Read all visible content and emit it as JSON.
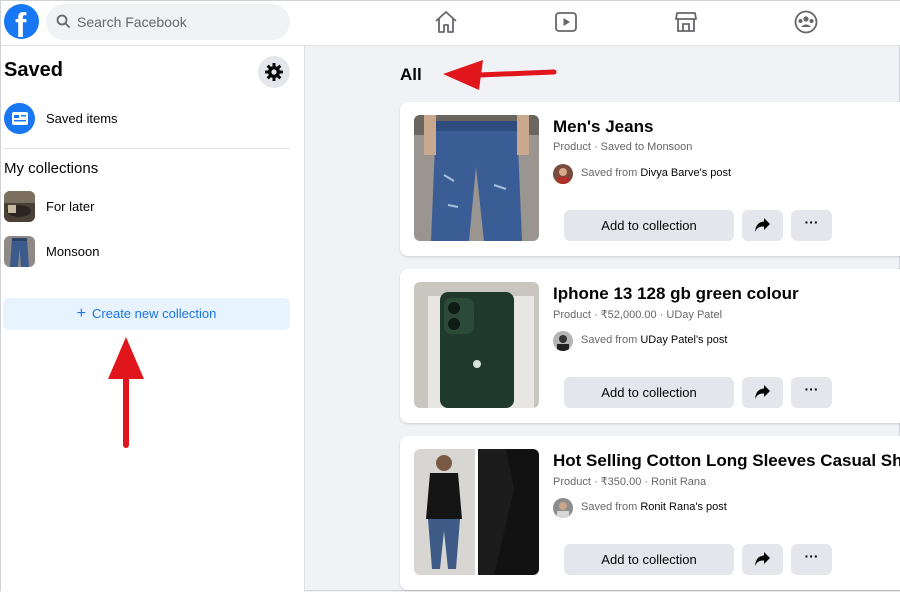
{
  "header": {
    "logo_letter": "f",
    "search_placeholder": "Search Facebook",
    "nav": [
      "home-icon",
      "watch-icon",
      "marketplace-icon",
      "groups-icon"
    ]
  },
  "sidebar": {
    "title": "Saved",
    "saved_items_label": "Saved items",
    "collections_heading": "My collections",
    "collections": [
      {
        "label": "For later"
      },
      {
        "label": "Monsoon"
      }
    ],
    "create_label": "Create new collection",
    "create_icon": "+"
  },
  "main": {
    "title": "All",
    "cards": [
      {
        "name": "Men's Jeans",
        "meta": "Product · Saved to Monsoon",
        "saved_from": "Saved from",
        "source": "Divya Barve's post",
        "add_label": "Add to collection",
        "more_label": "···"
      },
      {
        "name": "Iphone 13 128 gb green colour",
        "meta": "Product · ₹52,000.00 · UDay Patel",
        "saved_from": "Saved from",
        "source": "UDay Patel's post",
        "add_label": "Add to collection",
        "more_label": "···"
      },
      {
        "name": "Hot Selling Cotton Long Sleeves Casual Sh",
        "meta": "Product · ₹350.00 · Ronit Rana",
        "saved_from": "Saved from",
        "source": "Ronit Rana's post",
        "add_label": "Add to collection",
        "more_label": "···"
      }
    ]
  },
  "colors": {
    "brand": "#1877f2",
    "annotation_arrow": "#e0161c",
    "create_button_bg": "#e7f3ff"
  }
}
